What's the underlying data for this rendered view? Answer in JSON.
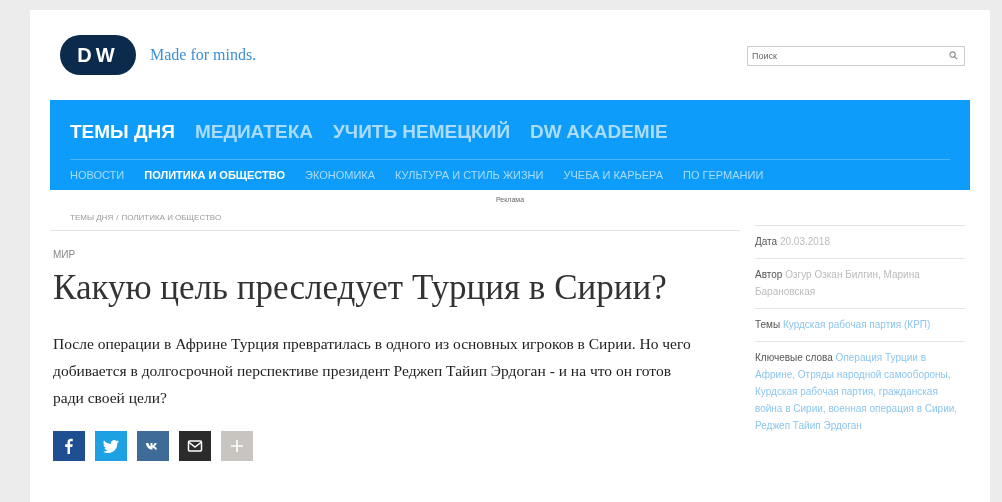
{
  "header": {
    "logo": "DW",
    "tagline": "Made for minds.",
    "search": {
      "placeholder": "Поиск"
    }
  },
  "main_nav": [
    {
      "label": "ТЕМЫ ДНЯ",
      "selected": true
    },
    {
      "label": "МЕДИАТЕКА",
      "selected": false
    },
    {
      "label": "УЧИТЬ НЕМЕЦКИЙ",
      "selected": false
    },
    {
      "label": "DW AKADEMIE",
      "selected": false
    }
  ],
  "sub_nav": [
    {
      "label": "НОВОСТИ",
      "selected": false
    },
    {
      "label": "ПОЛИТИКА И ОБЩЕСТВО",
      "selected": true
    },
    {
      "label": "ЭКОНОМИКА",
      "selected": false
    },
    {
      "label": "КУЛЬТУРА И СТИЛЬ ЖИЗНИ",
      "selected": false
    },
    {
      "label": "УЧЕБА И КАРЬЕРА",
      "selected": false
    },
    {
      "label": "ПО ГЕРМАНИИ",
      "selected": false
    }
  ],
  "ad_label": "Реклама",
  "breadcrumb": {
    "separator": "/",
    "items": [
      "ТЕМЫ ДНЯ",
      "ПОЛИТИКА И ОБЩЕСТВО"
    ]
  },
  "article": {
    "category": "МИР",
    "title": "Какую цель преследует Турция в Сирии?",
    "lead": "После операции в Африне Турция превратилась в одного из основных игроков в Сирии. Но чего добивается в долгосрочной перспективе президент Реджеп Тайип Эрдоган - и на что он готов ради своей цели?",
    "share": [
      {
        "kind": "facebook"
      },
      {
        "kind": "twitter"
      },
      {
        "kind": "vk"
      },
      {
        "kind": "email"
      },
      {
        "kind": "more"
      }
    ]
  },
  "sidebar": [
    {
      "label": "Дата",
      "value": "20.03.2018"
    },
    {
      "label": "Автор",
      "value": "Озгур Озкан Билгин, Марина Барановская"
    },
    {
      "label": "Темы",
      "value": "Курдская рабочая партия (КРП)"
    },
    {
      "label": "Ключевые слова",
      "value": "Операция Турции в Африне, Отряды народной самообороны, Курдская рабочая партия, гражданская война в Сирии, военная операция в Сирии, Реджеп Тайип Эрдоган"
    }
  ]
}
